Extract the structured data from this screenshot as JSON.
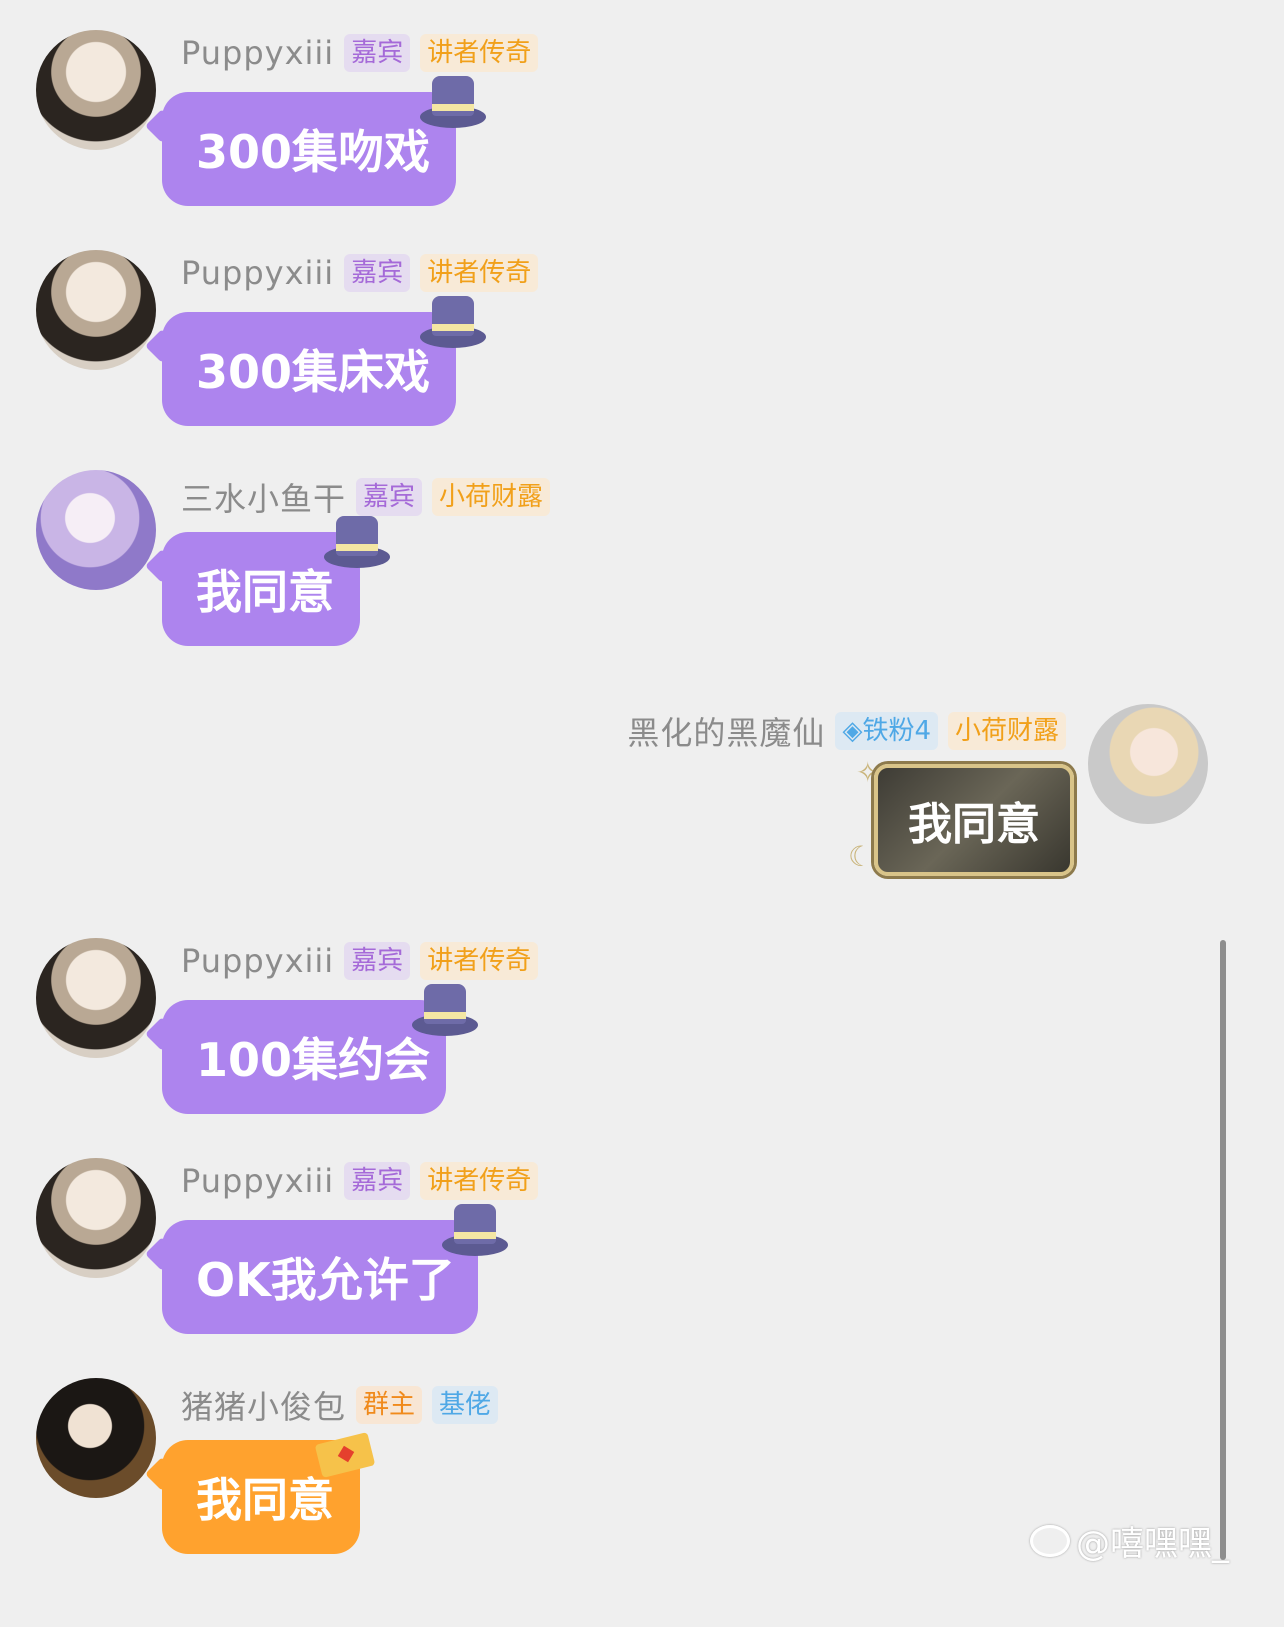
{
  "messages": [
    {
      "name": "Puppyxiii",
      "tag1": "嘉宾",
      "tag2": "讲者传奇",
      "text": "300集吻戏"
    },
    {
      "name": "Puppyxiii",
      "tag1": "嘉宾",
      "tag2": "讲者传奇",
      "text": "300集床戏"
    },
    {
      "name": "三水小鱼干",
      "tag1": "嘉宾",
      "tag2": "小荷财露",
      "text": "我同意"
    },
    {
      "name": "黑化的黑魔仙",
      "tag1": "铁粉4",
      "tag2": "小荷财露",
      "text": "我同意"
    },
    {
      "name": "Puppyxiii",
      "tag1": "嘉宾",
      "tag2": "讲者传奇",
      "text": "100集约会"
    },
    {
      "name": "Puppyxiii",
      "tag1": "嘉宾",
      "tag2": "讲者传奇",
      "text": "OK我允许了"
    },
    {
      "name": "猪猪小俊包",
      "tag1": "群主",
      "tag2": "基佬",
      "text": "我同意"
    }
  ],
  "watermark": "@嘻嘿嘿_",
  "colors": {
    "purple_bubble": "#ad84ee",
    "orange_bubble": "#ffa22e",
    "background": "#efefef"
  }
}
